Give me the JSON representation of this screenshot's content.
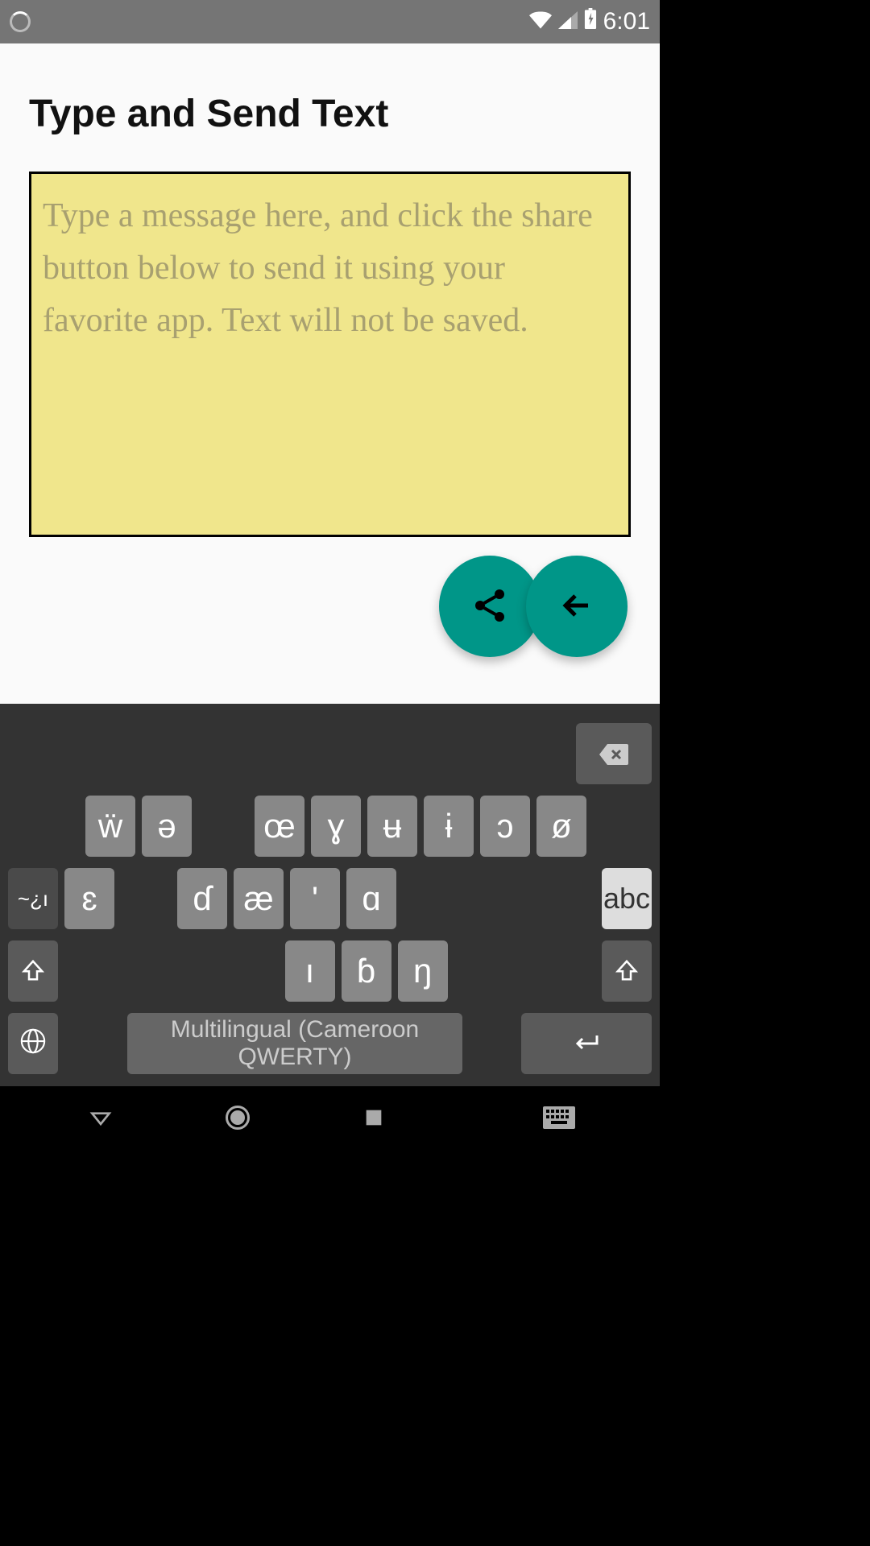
{
  "status_bar": {
    "time": "6:01"
  },
  "main": {
    "title": "Type and Send Text",
    "placeholder": "Type a message here, and click the share button below to send it using your favorite app. Text will not be saved.",
    "value": ""
  },
  "fab": {
    "share": "share-icon",
    "back": "back-arrow-icon"
  },
  "keyboard": {
    "row1": [
      "ẅ",
      "ə",
      "",
      "œ",
      "ɣ",
      "ʉ",
      "ɨ",
      "ɔ",
      "ø"
    ],
    "row2_diac": "~¿ı",
    "row2": [
      "ɛ",
      "",
      "ɗ",
      "æ",
      "'",
      "ɑ"
    ],
    "row2_abc": "abc",
    "row3": [
      "ı",
      "ɓ",
      "ŋ"
    ],
    "space_label": "Multilingual (Cameroon QWERTY)"
  },
  "colors": {
    "accent": "#009688",
    "message_bg": "#f0e68c",
    "status_bg": "#757575"
  }
}
